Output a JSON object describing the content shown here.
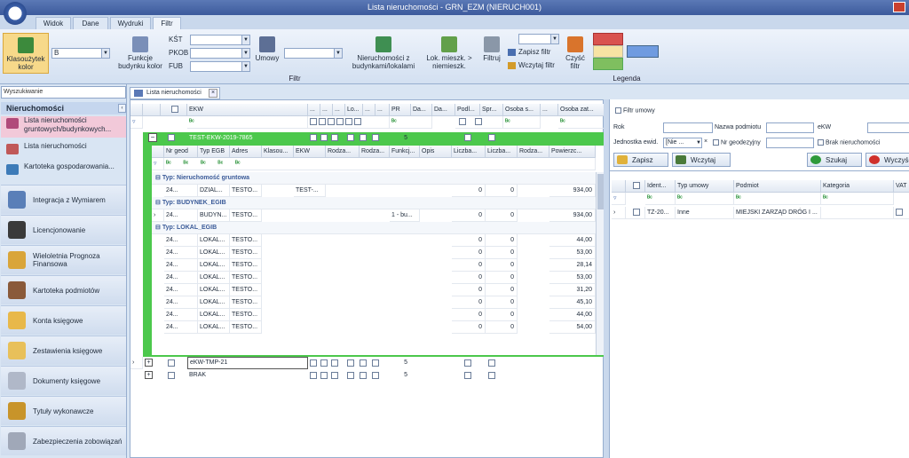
{
  "window": {
    "title": "Lista nieruchomości - GRN_EZM (NIERUCH001)"
  },
  "ribbon_tabs": [
    "Widok",
    "Dane",
    "Wydruki",
    "Filtr"
  ],
  "ribbon": {
    "klasouzytek": "Klasoużytek kolor",
    "b_value": "B",
    "funkcje": "Funkcje budynku kolor",
    "kst": "KŚT",
    "pkob": "PKOB",
    "fub": "FUB",
    "umowy": "Umowy",
    "nieruch_bud": "Nieruchomości z budynkami/lokalami",
    "lok_mieszk": "Lok. mieszk. > niemieszk.",
    "filtruj": "Filtruj",
    "zapisz_filtr": "Zapisz filtr",
    "wczytaj_filtr": "Wczytaj filtr",
    "czysc_filtr": "Czyść filtr",
    "group_filtr": "Filtr",
    "group_legenda": "Legenda",
    "legend_colors": [
      "#d9534f",
      "#f7e3a3",
      "#7fbf5f",
      "#6f9be0"
    ]
  },
  "left": {
    "search": "Wyszukiwanie",
    "section": "Nieruchomości",
    "items": [
      "Lista nieruchomości gruntowych/budynkowych...",
      "Lista nieruchomości",
      "Kartoteka gospodarowania..."
    ],
    "big": [
      "Integracja z Wymiarem",
      "Licencjonowanie",
      "Wieloletnia Prognoza Finansowa",
      "Kartoteka podmiotów",
      "Konta księgowe",
      "Zestawienia księgowe",
      "Dokumenty księgowe",
      "Tytuły wykonawcze",
      "Zabezpieczenia zobowiązań"
    ]
  },
  "doc_tab": "Lista nieruchomości",
  "main": {
    "headers": [
      "EKW",
      "...",
      "...",
      "...",
      "Lo...",
      "...",
      "...",
      "PR",
      "Da...",
      "Da...",
      "Podl...",
      "Spr...",
      "Osoba s...",
      "...",
      "Osoba zat..."
    ],
    "filter_symbol": "ᴮᶜ",
    "rows": [
      {
        "ekw": "TEST-EKW-2019-7865",
        "pr": "5"
      },
      {
        "ekw": "eKW-TMP-21",
        "pr": "5"
      },
      {
        "ekw": "BRAK",
        "pr": "5"
      }
    ],
    "sub_headers": [
      "Nr geod",
      "Typ EGB",
      "Adres",
      "Klasou...",
      "EKW",
      "Rodza...",
      "Rodza...",
      "Funkcj...",
      "Opis",
      "Liczba...",
      "Liczba...",
      "Rodza...",
      "Powierzc..."
    ],
    "groups": [
      "Typ: Nieruchomość gruntowa",
      "Typ: BUDYNEK_EGIB",
      "Typ: LOKAL_EGIB"
    ],
    "grunt": [
      {
        "nr": "24...",
        "typ": "DZIAL...",
        "adres": "TESTO...",
        "ekw": "TEST-...",
        "l1": "0",
        "l2": "0",
        "pow": "934,00"
      }
    ],
    "budynek": [
      {
        "nr": "24...",
        "typ": "BUDYN...",
        "adres": "TESTO...",
        "funk": "1 - bu...",
        "l1": "0",
        "l2": "0",
        "pow": "934,00"
      }
    ],
    "lokale": [
      {
        "nr": "24...",
        "typ": "LOKAL...",
        "adres": "TESTO...",
        "l1": "0",
        "l2": "0",
        "pow": "44,00"
      },
      {
        "nr": "24...",
        "typ": "LOKAL...",
        "adres": "TESTO...",
        "l1": "0",
        "l2": "0",
        "pow": "53,00"
      },
      {
        "nr": "24...",
        "typ": "LOKAL...",
        "adres": "TESTO...",
        "l1": "0",
        "l2": "0",
        "pow": "28,14"
      },
      {
        "nr": "24...",
        "typ": "LOKAL...",
        "adres": "TESTO...",
        "l1": "0",
        "l2": "0",
        "pow": "53,00"
      },
      {
        "nr": "24...",
        "typ": "LOKAL...",
        "adres": "TESTO...",
        "l1": "0",
        "l2": "0",
        "pow": "31,20"
      },
      {
        "nr": "24...",
        "typ": "LOKAL...",
        "adres": "TESTO...",
        "l1": "0",
        "l2": "0",
        "pow": "45,10"
      },
      {
        "nr": "24...",
        "typ": "LOKAL...",
        "adres": "TESTO...",
        "l1": "0",
        "l2": "0",
        "pow": "44,00"
      },
      {
        "nr": "24...",
        "typ": "LOKAL...",
        "adres": "TESTO...",
        "l1": "0",
        "l2": "0",
        "pow": "54,00"
      }
    ]
  },
  "right": {
    "title": "Filtr umowy",
    "rok": "Rok",
    "nazwa": "Nazwa podmiotu",
    "ekw": "eKW",
    "jedn": "Jednostka ewid.",
    "jedn_val": "[Nie ...",
    "nrgeod": "Nr geodezyjny",
    "brak": "Brak nieruchomości",
    "zapisz": "Zapisz",
    "wczytaj": "Wczytaj",
    "szukaj": "Szukaj",
    "wyczysc": "Wyczyść",
    "headers": [
      "Ident...",
      "Typ umowy",
      "Podmiot",
      "Kategoria",
      "VAT"
    ],
    "row": {
      "id": "TZ-20...",
      "typ": "Inne",
      "podmiot": "MIEJSKI ZARZĄD DRÓG I ..."
    }
  }
}
